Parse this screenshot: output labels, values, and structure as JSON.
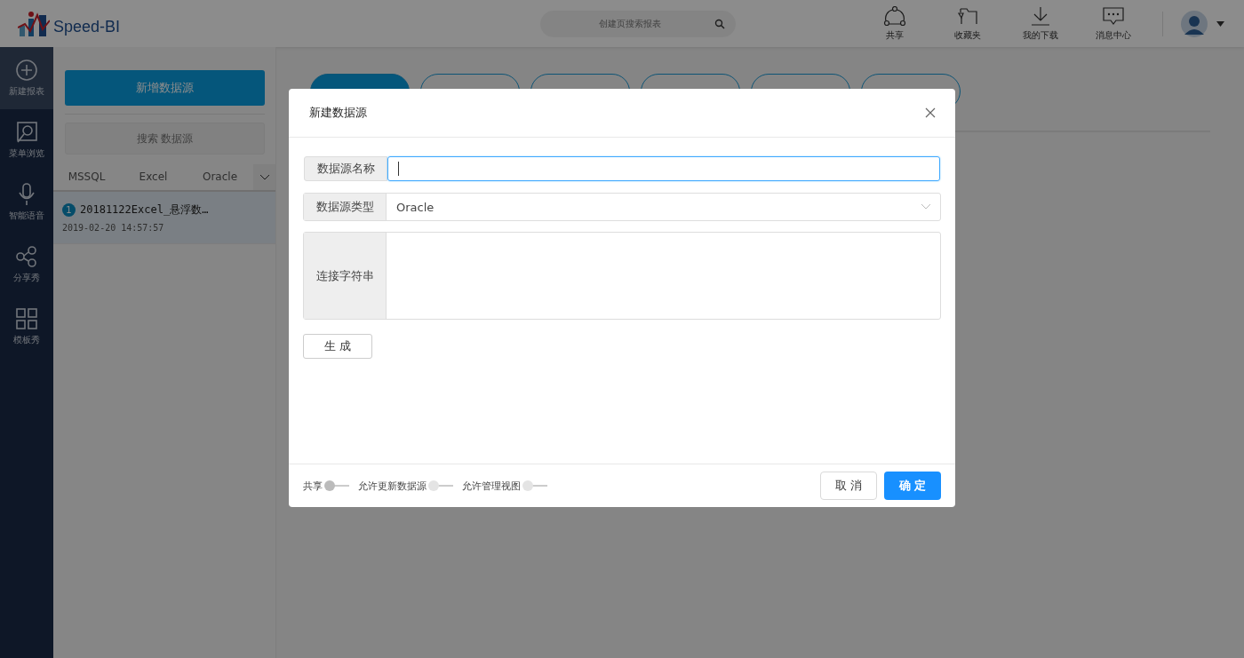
{
  "header": {
    "logo": "Speed-BI",
    "search": {
      "placeholder": "创建页搜索报表"
    },
    "actions": [
      {
        "label": "共享",
        "kind": "share"
      },
      {
        "label": "收藏夹",
        "kind": "folder"
      },
      {
        "label": "我的下载",
        "kind": "download"
      },
      {
        "label": "消息中心",
        "kind": "message"
      }
    ]
  },
  "nav": [
    {
      "label": "新建报表",
      "kind": "plus",
      "selected": true
    },
    {
      "label": "菜单浏览",
      "kind": "browse",
      "selected": false
    },
    {
      "label": "智能语音",
      "kind": "mic",
      "selected": false
    },
    {
      "label": "分享秀",
      "kind": "share",
      "selected": false
    },
    {
      "label": "模板秀",
      "kind": "grid",
      "selected": false
    }
  ],
  "sidebar": {
    "add_button": "新增数据源",
    "search": {
      "placeholder": "搜索 数据源"
    },
    "tabs": [
      {
        "label": "MSSQL",
        "selected": false
      },
      {
        "label": "Excel",
        "selected": false
      },
      {
        "label": "Oracle",
        "selected": false
      }
    ],
    "items": [
      {
        "badge": "1",
        "title": "20181122Excel_悬浮数…",
        "date": "2019-02-20 14:57:57",
        "selected": true
      }
    ]
  },
  "toolbar_buttons": [
    {
      "selected": true
    },
    {
      "selected": false
    },
    {
      "selected": false
    },
    {
      "selected": false
    },
    {
      "selected": false
    },
    {
      "selected": false
    }
  ],
  "dialog": {
    "title": "新建数据源",
    "fields": [
      {
        "label": "数据源名称",
        "kind": "input",
        "focused": true
      },
      {
        "label": "数据源类型",
        "kind": "select",
        "value": "Oracle"
      },
      {
        "label": "连接字符串",
        "kind": "textarea"
      }
    ],
    "generate_button": "生 成",
    "toggles": [
      {
        "label": "共享",
        "on": false,
        "disabled": false
      },
      {
        "label": "允许更新数据源",
        "on": false,
        "disabled": true
      },
      {
        "label": "允许管理视图",
        "on": false,
        "disabled": true
      }
    ],
    "cancel_button": "取 消",
    "ok_button": "确 定"
  }
}
